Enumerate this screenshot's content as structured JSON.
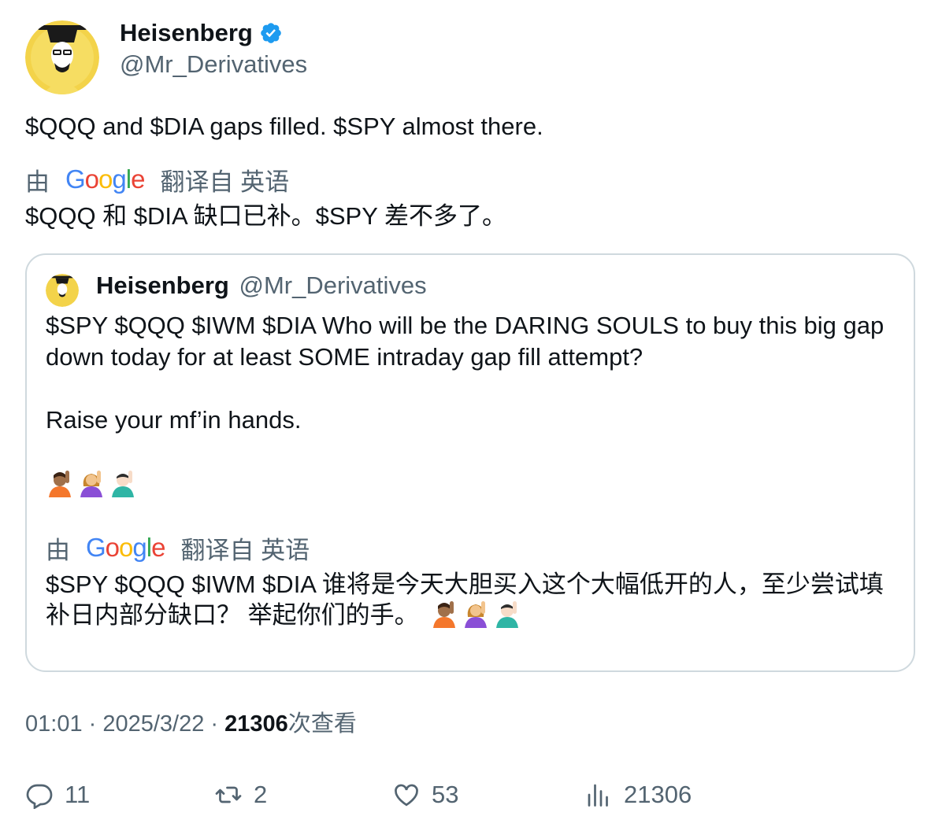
{
  "author": {
    "name": "Heisenberg",
    "handle": "@Mr_Derivatives",
    "verified": true
  },
  "tweet": {
    "text": "$QQQ and $DIA gaps filled. $SPY almost there.",
    "translated_by_prefix": "由",
    "translated_by_service": "Google",
    "translated_by_suffix": "翻译自 英语",
    "translation": "$QQQ 和 $DIA 缺口已补。$SPY 差不多了。"
  },
  "quoted_tweet": {
    "name": "Heisenberg",
    "handle": "@Mr_Derivatives",
    "line1": "$SPY $QQQ $IWM $DIA Who will be the DARING SOULS to buy this big gap down today for at least SOME intraday gap fill attempt?",
    "line2": "Raise your mf’in hands.",
    "emojis": [
      "person-raising-hand-emoji",
      "woman-raising-hand-emoji",
      "man-raising-hand-emoji"
    ],
    "translated_by_prefix": "由",
    "translated_by_service": "Google",
    "translated_by_suffix": "翻译自 英语",
    "translation": "$SPY $QQQ $IWM $DIA 谁将是今天大胆买入这个大幅低开的人，至少尝试填补日内部分缺口？ 举起你们的手。"
  },
  "meta": {
    "time": "01:01",
    "separator": " · ",
    "date": "2025/3/22",
    "views_count": "21306",
    "views_label": "次查看"
  },
  "actions": {
    "replies": "11",
    "retweets": "2",
    "likes": "53",
    "views": "21306"
  },
  "colors": {
    "text": "#0f1419",
    "secondary": "#536471",
    "border": "#cfd9de",
    "verified": "#1d9bf0"
  }
}
